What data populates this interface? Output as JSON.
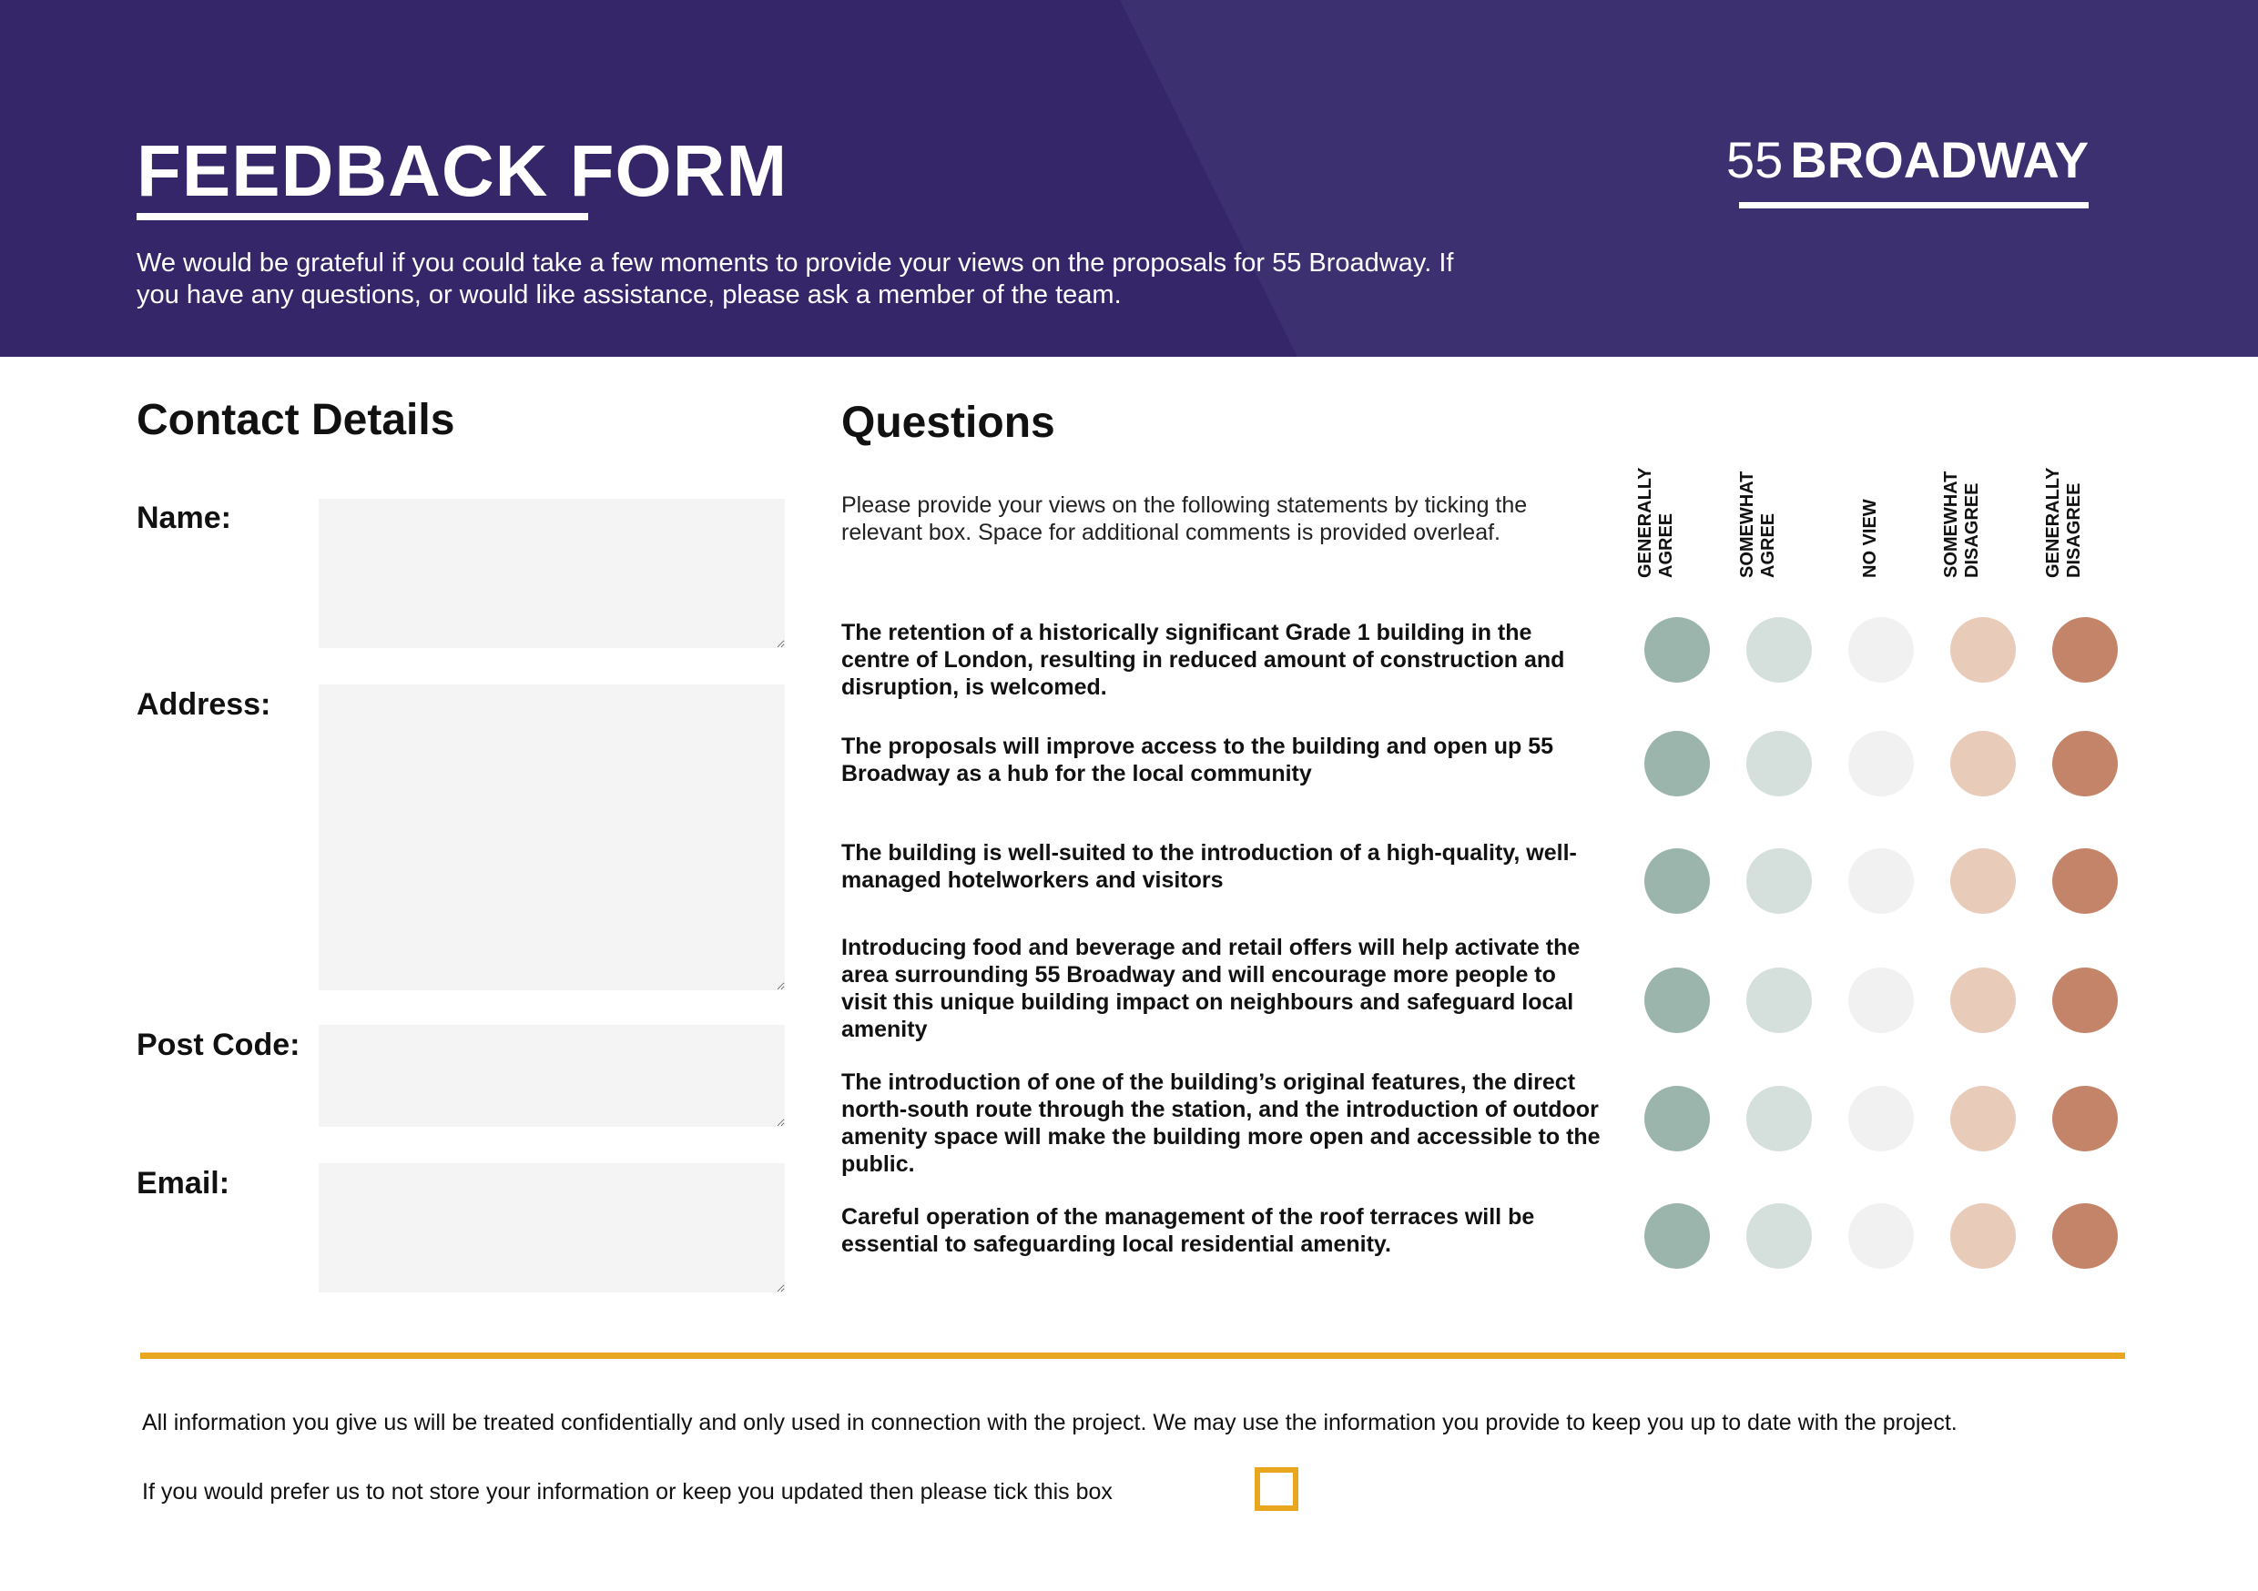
{
  "header": {
    "title": "FEEDBACK FORM",
    "intro": "We would be grateful if you could take a few moments to provide your views on the proposals for 55 Broadway. If you have any questions, or would like assistance, please ask a member of the team.",
    "logo_number": "55",
    "logo_text": "BROADWAY"
  },
  "contact": {
    "heading": "Contact Details",
    "fields": [
      {
        "label": "Name:",
        "value": ""
      },
      {
        "label": "Address:",
        "value": ""
      },
      {
        "label": "Post Code:",
        "value": ""
      },
      {
        "label": "Email:",
        "value": ""
      }
    ]
  },
  "questions": {
    "heading": "Questions",
    "intro": "Please provide your views on the following statements by ticking the relevant box. Space for additional comments is provided overleaf.",
    "scale": [
      {
        "label": "GENERALLY\nAGREE",
        "color": "#9bb5ac"
      },
      {
        "label": "SOMEWHAT\nAGREE",
        "color": "#d5e0dc"
      },
      {
        "label": "NO VIEW",
        "color": "#f1f1f1"
      },
      {
        "label": "SOMEWHAT\nDISAGREE",
        "color": "#e9cbb9"
      },
      {
        "label": "GENERALLY\nDISAGREE",
        "color": "#c4846a"
      }
    ],
    "items": [
      "The retention of a historically significant Grade 1 building in the centre of London, resulting in reduced amount of construction and disruption, is welcomed.",
      "The proposals will improve access to the building and open up 55 Broadway as a hub for the local community",
      "The building is well-suited to the introduction of a high-quality, well-managed hotelworkers and visitors",
      "Introducing food and beverage and retail offers will help activate the area surrounding 55 Broadway and will encourage more people to visit this unique building   impact on neighbours and safeguard local amenity",
      "The introduction of one of the building’s original features, the direct north-south route through the station, and the introduction of outdoor amenity space will make the building more open and accessible to the public.",
      "Careful operation of the management of the roof terraces will be essential to safeguarding local residential amenity."
    ]
  },
  "footer": {
    "privacy": "All information you give us will be treated confidentially and only used in connection with the project. We may use the information you provide to keep you up to date with the project.",
    "optout": "If you would prefer us to not store your information or keep you updated then please tick this box",
    "optout_checked": false
  }
}
